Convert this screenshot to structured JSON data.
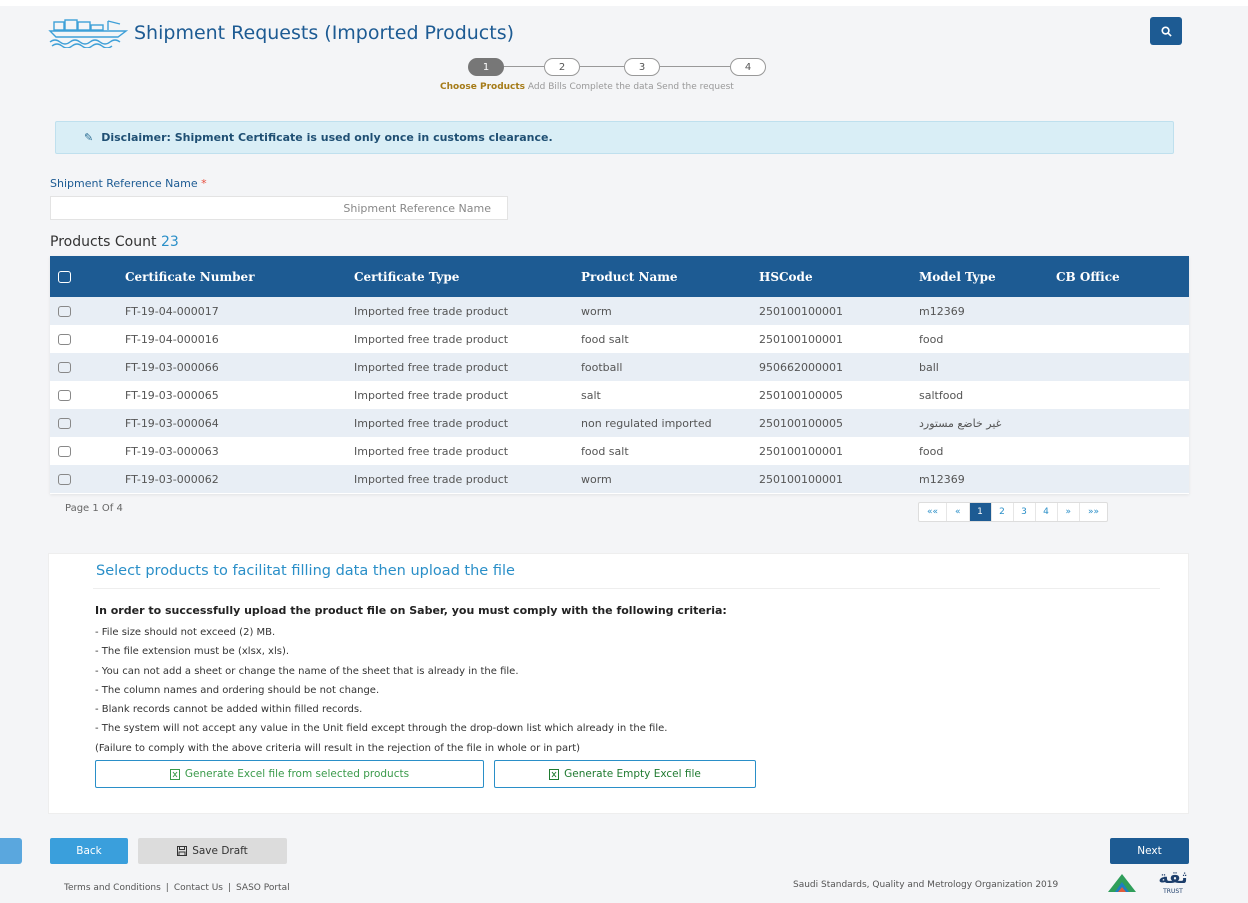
{
  "header": {
    "title": "Shipment Requests (Imported Products)"
  },
  "stepper": {
    "steps": [
      {
        "num": "1",
        "label": "Choose Products"
      },
      {
        "num": "2",
        "label": "Add Bills"
      },
      {
        "num": "3",
        "label": "Complete the data"
      },
      {
        "num": "4",
        "label": "Send the request"
      }
    ],
    "active_step": 1
  },
  "disclaimer": {
    "text": "Disclaimer: Shipment Certificate is used only once in customs clearance."
  },
  "reference": {
    "label": "Shipment Reference Name",
    "required_mark": "*",
    "placeholder": "Shipment Reference Name",
    "value": ""
  },
  "products": {
    "count_label": "Products Count",
    "count": "23",
    "columns": [
      "Certificate Number",
      "Certificate Type",
      "Product Name",
      "HSCode",
      "Model Type",
      "CB Office"
    ],
    "rows": [
      {
        "cert": "FT-19-04-000017",
        "type": "Imported free trade product",
        "product": "worm",
        "hscode": "250100100001",
        "model": "m12369",
        "cb": ""
      },
      {
        "cert": "FT-19-04-000016",
        "type": "Imported free trade product",
        "product": "food salt",
        "hscode": "250100100001",
        "model": "food",
        "cb": ""
      },
      {
        "cert": "FT-19-03-000066",
        "type": "Imported free trade product",
        "product": "football",
        "hscode": "950662000001",
        "model": "ball",
        "cb": ""
      },
      {
        "cert": "FT-19-03-000065",
        "type": "Imported free trade product",
        "product": "salt",
        "hscode": "250100100005",
        "model": "saltfood",
        "cb": ""
      },
      {
        "cert": "FT-19-03-000064",
        "type": "Imported free trade product",
        "product": "non regulated imported",
        "hscode": "250100100005",
        "model": "غير خاضع مستورد",
        "cb": ""
      },
      {
        "cert": "FT-19-03-000063",
        "type": "Imported free trade product",
        "product": "food salt",
        "hscode": "250100100001",
        "model": "food",
        "cb": ""
      },
      {
        "cert": "FT-19-03-000062",
        "type": "Imported free trade product",
        "product": "worm",
        "hscode": "250100100001",
        "model": "m12369",
        "cb": ""
      }
    ]
  },
  "pagination": {
    "summary": "Page 1 Of 4",
    "first": "««",
    "prev": "«",
    "pages": [
      "1",
      "2",
      "3",
      "4"
    ],
    "active_page": "1",
    "next": "»",
    "last": "»»"
  },
  "upload": {
    "title": "Select products to facilitat filling data then upload the file",
    "criteria_heading": "In order to successfully upload the product file on Saber, you must comply with the following criteria:",
    "criteria": [
      "- File size should not exceed (2) MB.",
      "- The file extension must be (xlsx, xls).",
      "- You can not add a sheet or change the name of the sheet that is already in the file.",
      "- The column names and ordering should be not change.",
      "- Blank records cannot be added within filled records.",
      "- The system will not accept any value in the Unit field except through the drop-down list which already in the file.",
      "(Failure to comply with the above criteria will result in the rejection of the file in whole or in part)"
    ],
    "btn_generate_selected": "Generate Excel file from selected products",
    "btn_generate_empty": "Generate Empty Excel file"
  },
  "actions": {
    "back": "Back",
    "save_draft": "Save Draft",
    "next": "Next"
  },
  "footer": {
    "links": [
      "Terms and Conditions",
      "Contact Us",
      "SASO Portal"
    ],
    "org": "Saudi Standards, Quality and Metrology Organization  2019",
    "logo_text": "ثقة",
    "logo_subtext": "TRUST"
  },
  "colors": {
    "primary": "#1d5b93",
    "accent": "#2a8fc8",
    "disclaimer_bg": "#d9eef6"
  }
}
